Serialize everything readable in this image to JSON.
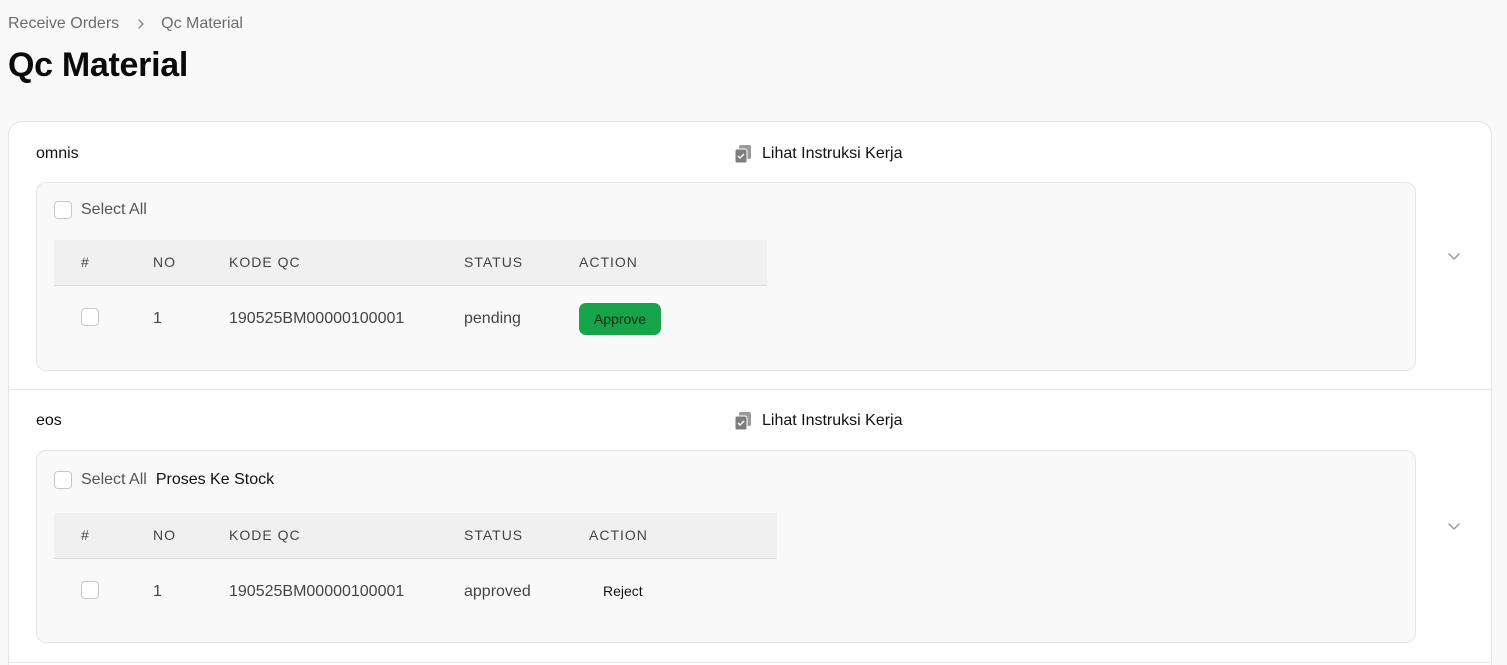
{
  "breadcrumb": {
    "parent": "Receive Orders",
    "current": "Qc Material"
  },
  "page_title": "Qc Material",
  "colors": {
    "approve": "#16a34a",
    "background": "#f9f9f9"
  },
  "icons": {
    "instruction": "clipboard-check-icon",
    "separator": "chevron-right-icon",
    "expand": "chevron-down-icon"
  },
  "sections": [
    {
      "name": "omnis",
      "instruction_label": "Lihat Instruksi Kerja",
      "select_all_label": "Select All",
      "columns": [
        "#",
        "NO",
        "KODE QC",
        "STATUS",
        "ACTION"
      ],
      "rows": [
        {
          "no": "1",
          "kode_qc": "190525BM00000100001",
          "status": "pending",
          "action": "Approve"
        }
      ]
    },
    {
      "name": "eos",
      "instruction_label": "Lihat Instruksi Kerja",
      "select_all_label": "Select All",
      "bulk_action_label": "Proses Ke Stock",
      "columns": [
        "#",
        "NO",
        "KODE QC",
        "STATUS",
        "ACTION"
      ],
      "rows": [
        {
          "no": "1",
          "kode_qc": "190525BM00000100001",
          "status": "approved",
          "action": "Reject"
        }
      ]
    }
  ]
}
